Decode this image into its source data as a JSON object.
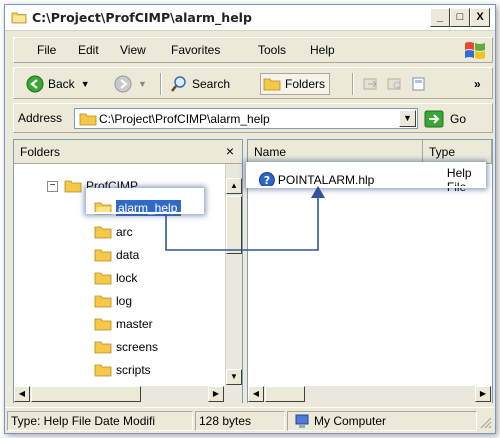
{
  "window": {
    "title": "C:\\Project\\ProfCIMP\\alarm_help",
    "minimize_label": "_",
    "maximize_label": "□",
    "close_label": "X"
  },
  "menubar": {
    "items": [
      "File",
      "Edit",
      "View",
      "Favorites",
      "Tools",
      "Help"
    ]
  },
  "toolbar": {
    "back_label": "Back",
    "search_label": "Search",
    "folders_label": "Folders",
    "more_label": "»"
  },
  "address": {
    "label": "Address",
    "value": "C:\\Project\\ProfCIMP\\alarm_help",
    "go_label": "Go"
  },
  "folders_pane": {
    "header": "Folders",
    "close_label": "×",
    "expander_label": "−",
    "root": "ProfCIMP",
    "selected": "alarm_help",
    "children": [
      "arc",
      "data",
      "lock",
      "log",
      "master",
      "screens",
      "scripts"
    ]
  },
  "files_pane": {
    "columns": [
      "Name",
      "Type"
    ],
    "rows": [
      {
        "name": "POINTALARM.hlp",
        "type": "Help File"
      }
    ]
  },
  "statusbar": {
    "info": "Type: Help File Date Modifi",
    "size": "128 bytes",
    "zone": "My Computer"
  },
  "colors": {
    "selection": "#316ac5",
    "callout_line": "#3050a0",
    "window_face": "#ece9d8"
  }
}
